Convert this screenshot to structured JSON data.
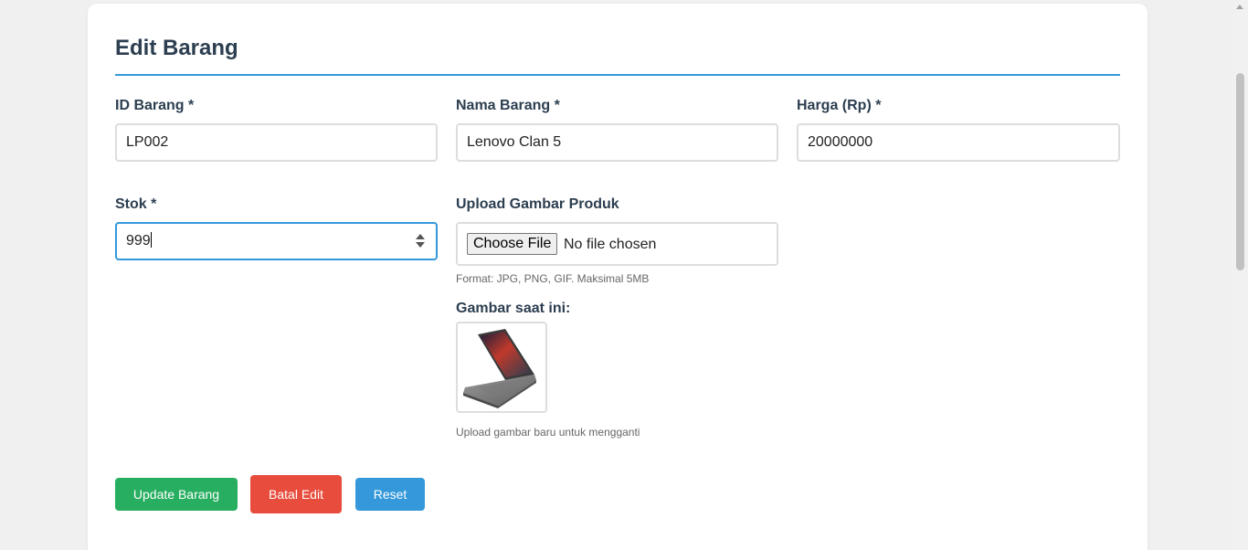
{
  "form": {
    "title": "Edit Barang",
    "fields": {
      "id": {
        "label": "ID Barang *",
        "value": "LP002"
      },
      "name": {
        "label": "Nama Barang *",
        "value": "Lenovo Clan 5"
      },
      "price": {
        "label": "Harga (Rp) *",
        "value": "20000000"
      },
      "stock": {
        "label": "Stok *",
        "value": "999"
      }
    },
    "upload": {
      "label": "Upload Gambar Produk",
      "button": "Choose File",
      "status": "No file chosen",
      "hint": "Format: JPG, PNG, GIF. Maksimal 5MB"
    },
    "current_image": {
      "label": "Gambar saat ini:",
      "icon": "laptop-product-image",
      "hint": "Upload gambar baru untuk mengganti"
    },
    "buttons": {
      "update": "Update Barang",
      "cancel": "Batal Edit",
      "reset": "Reset"
    }
  },
  "colors": {
    "accent": "#3498db",
    "success": "#27ae60",
    "danger": "#e74c3c",
    "heading": "#2c3e50"
  }
}
